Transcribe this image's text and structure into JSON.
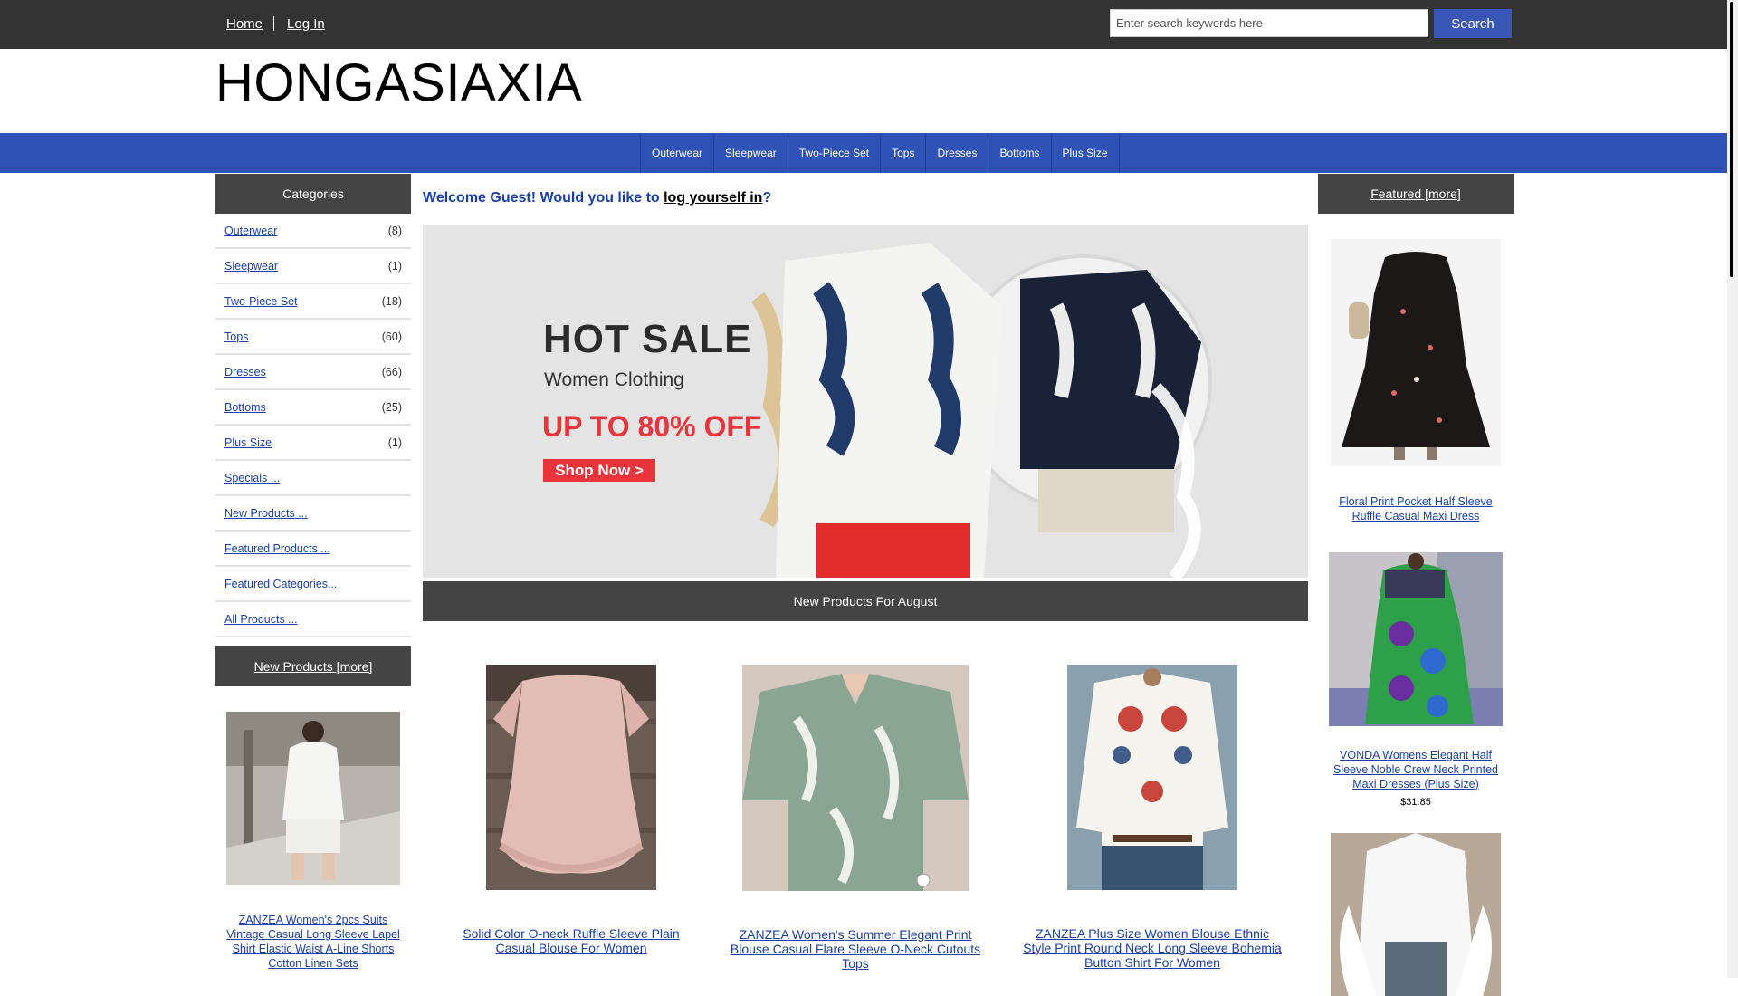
{
  "header": {
    "nav": [
      {
        "label": "Home"
      },
      {
        "label": "Log In"
      }
    ],
    "search_placeholder": "Enter search keywords here",
    "search_button": "Search",
    "logo": "HONGASIAXIA"
  },
  "category_bar": [
    {
      "label": "Outerwear"
    },
    {
      "label": "Sleepwear"
    },
    {
      "label": "Two-Piece Set"
    },
    {
      "label": "Tops"
    },
    {
      "label": "Dresses"
    },
    {
      "label": "Bottoms"
    },
    {
      "label": "Plus Size"
    }
  ],
  "sidebar": {
    "title": "Categories",
    "categories": [
      {
        "label": "Outerwear",
        "count": "(8)"
      },
      {
        "label": "Sleepwear",
        "count": "(1)"
      },
      {
        "label": "Two-Piece Set",
        "count": "(18)"
      },
      {
        "label": "Tops",
        "count": "(60)"
      },
      {
        "label": "Dresses",
        "count": "(66)"
      },
      {
        "label": "Bottoms",
        "count": "(25)"
      },
      {
        "label": "Plus Size",
        "count": "(1)"
      }
    ],
    "links": [
      {
        "label": "Specials ..."
      },
      {
        "label": "New Products ..."
      },
      {
        "label": "Featured Products ..."
      },
      {
        "label": "Featured Categories..."
      },
      {
        "label": "All Products ..."
      }
    ],
    "new_products_title": "New Products  [more]",
    "new_product": {
      "name": "ZANZEA Women's 2pcs Suits Vintage Casual Long Sleeve Lapel Shirt Elastic Waist A-Line Shorts Cotton Linen Sets"
    }
  },
  "main": {
    "welcome_prefix": "Welcome Guest! Would you like to ",
    "welcome_link": "log yourself in",
    "welcome_suffix": "?",
    "banner": {
      "title": "HOT SALE",
      "subtitle": "Women Clothing",
      "offer": "UP TO 80% OFF",
      "cta": "Shop Now >"
    },
    "new_products_heading": "New Products For August",
    "products": [
      {
        "name": "Solid Color O-neck Ruffle Sleeve Plain Casual Blouse For Women"
      },
      {
        "name": "ZANZEA Women's Summer Elegant Print Blouse Casual Flare Sleeve O-Neck Cutouts Tops"
      },
      {
        "name": "ZANZEA Plus Size Women Blouse Ethnic Style Print Round Neck Long Sleeve Bohemia Button Shirt For Women"
      }
    ]
  },
  "featured": {
    "title": "Featured  [more]",
    "items": [
      {
        "name": "Floral Print Pocket Half Sleeve Ruffle Casual Maxi Dress"
      },
      {
        "name": "VONDA Womens Elegant Half Sleeve Noble Crew Neck Printed Maxi Dresses (Plus Size)",
        "price": "$31.85"
      }
    ]
  },
  "colors": {
    "topbar": "#333333",
    "catbar": "#2f52b6",
    "accent": "#3a57b8",
    "banner_red": "#e8343a",
    "link": "#1a3fa6"
  }
}
